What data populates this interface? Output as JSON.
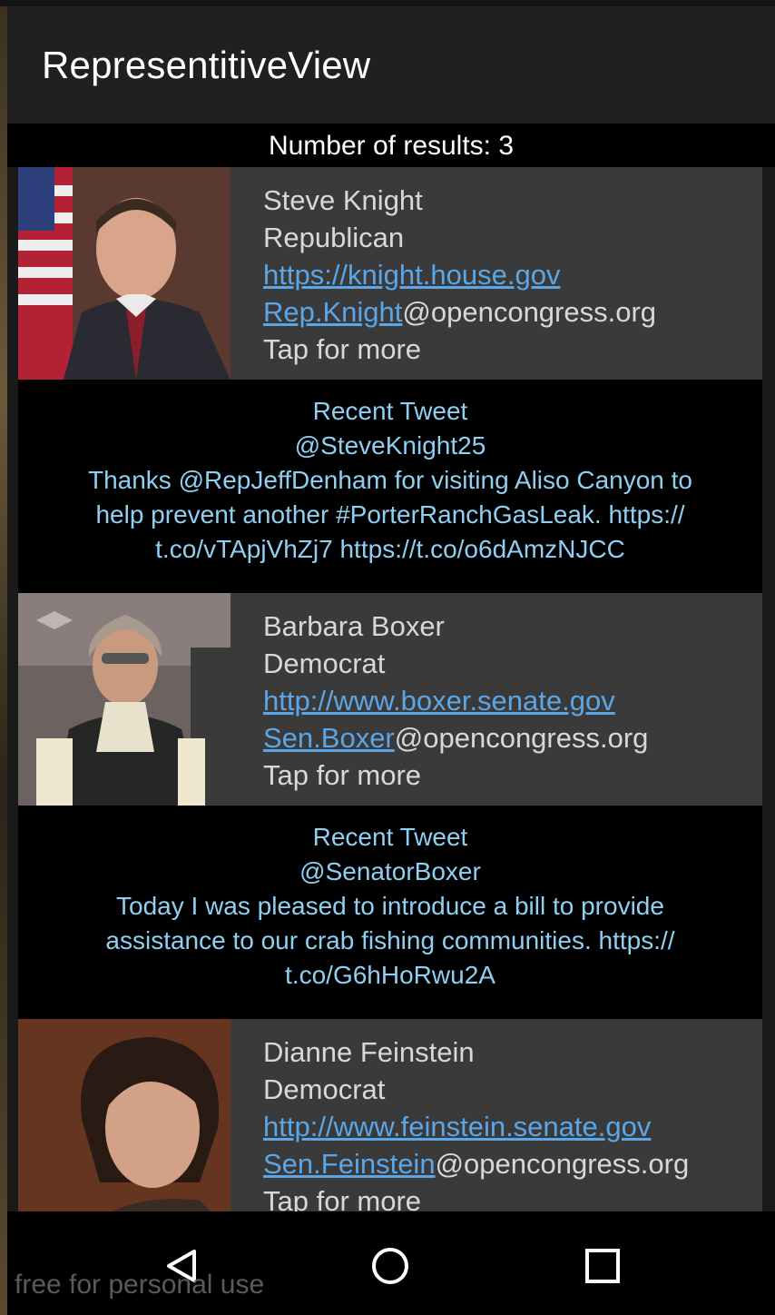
{
  "app": {
    "title": "RepresentitiveView"
  },
  "results": {
    "text": "Number of results: 3"
  },
  "reps": [
    {
      "name": "Steve Knight",
      "party": "Republican",
      "website": "https://knight.house.gov",
      "email_user": "Rep.Knight",
      "email_domain": "@opencongress.org",
      "more": "Tap for more",
      "tweet": {
        "header": "Recent Tweet",
        "handle": "@SteveKnight25",
        "lines": [
          "Thanks @RepJeffDenham for visiting Aliso Canyon to",
          "help prevent another #PorterRanchGasLeak. https://",
          "t.co/vTApjVhZj7 https://t.co/o6dAmzNJCC"
        ]
      }
    },
    {
      "name": "Barbara Boxer",
      "party": "Democrat",
      "website": "http://www.boxer.senate.gov",
      "email_user": "Sen.Boxer",
      "email_domain": "@opencongress.org",
      "more": "Tap for more",
      "tweet": {
        "header": "Recent Tweet",
        "handle": "@SenatorBoxer",
        "lines": [
          "Today I was pleased to introduce a bill to provide",
          "assistance to our crab fishing communities. https://",
          "t.co/G6hHoRwu2A"
        ]
      }
    },
    {
      "name": "Dianne Feinstein",
      "party": "Democrat",
      "website": "http://www.feinstein.senate.gov",
      "email_user": "Sen.Feinstein",
      "email_domain": "@opencongress.org",
      "more": "Tap for more"
    }
  ],
  "navbar": {
    "icons": [
      "back-icon",
      "home-icon",
      "recents-icon"
    ]
  },
  "watermark": {
    "text": "free for personal use"
  },
  "colors": {
    "link": "#5aa6e6",
    "tweet_text": "#8fd0f2",
    "card_bg": "#3a3a3a"
  }
}
